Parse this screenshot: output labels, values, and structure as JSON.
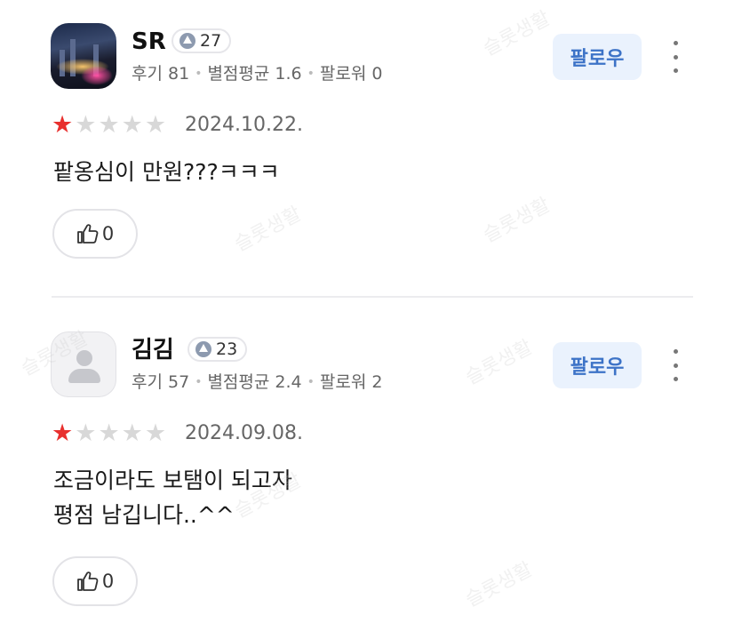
{
  "reviews": [
    {
      "name": "SR",
      "level": "27",
      "stats": {
        "reviews_label": "후기 81",
        "rating_label": "별점평균 1.6",
        "followers_label": "팔로워 0"
      },
      "follow_label": "팔로우",
      "stars": 1,
      "date": "2024.10.22.",
      "content": "팥옹심이 만원???ㅋㅋㅋ",
      "likes": "0",
      "avatar": "photo"
    },
    {
      "name": "김김",
      "level": "23",
      "stats": {
        "reviews_label": "후기 57",
        "rating_label": "별점평균 2.4",
        "followers_label": "팔로워 2"
      },
      "follow_label": "팔로우",
      "stars": 1,
      "date": "2024.09.08.",
      "content": "조금이라도 보탬이 되고자\n평점 남깁니다..^^",
      "likes": "0",
      "avatar": "default-profile-icon"
    }
  ],
  "colors": {
    "star_on": "#e8302e",
    "star_off": "#d8d8d8",
    "follow_bg": "#eaf2fd",
    "follow_text": "#3d73c7"
  },
  "watermark": "슬롯생활"
}
